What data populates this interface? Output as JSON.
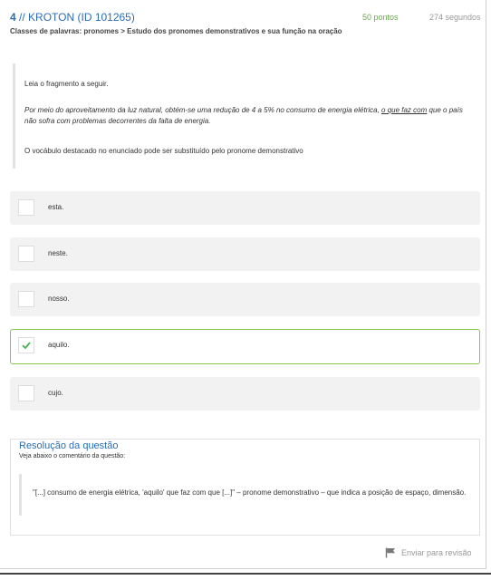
{
  "header": {
    "number": "4",
    "title": "// KROTON (ID 101265)",
    "points": "50 pontos",
    "seconds": "274 segundos",
    "breadcrumb": "Classes de palavras: pronomes > Estudo dos pronomes demonstrativos e sua função na oração"
  },
  "statement": {
    "intro": "Leia o fragmento a seguir.",
    "quote_before": "Por meio do aproveitamento da luz natural, obtém-se uma redução de 4 a 5% no consumo de energia elétrica, ",
    "quote_underlined": "o que faz com",
    "quote_after": " que o país não sofra com problemas decorrentes da falta de energia.",
    "question": "O vocábulo destacado no enunciado pode ser substituído pelo pronome demonstrativo"
  },
  "options": [
    {
      "label": "esta.",
      "selected": false
    },
    {
      "label": "neste.",
      "selected": false
    },
    {
      "label": "nosso.",
      "selected": false
    },
    {
      "label": "aquilo.",
      "selected": true
    },
    {
      "label": "cujo.",
      "selected": false
    }
  ],
  "resolution": {
    "title": "Resolução da questão",
    "subtitle": "Veja abaixo o comentário da questão:",
    "comment": "\"[...] consumo de energia elétrica, 'aquilo' que faz com que [...]\" – pronome demonstrativo – que indica a posição de espaço, dimensão."
  },
  "actions": {
    "review_label": "Enviar para revisão"
  },
  "colors": {
    "accent": "#2a6cb5",
    "correct": "#8bc34a",
    "points": "#6aa84f"
  },
  "icons": {
    "check": "check-icon",
    "flag": "flag-icon"
  }
}
